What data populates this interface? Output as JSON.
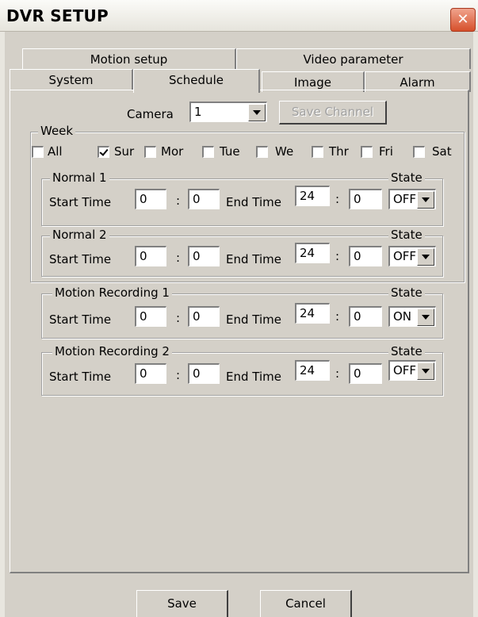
{
  "window": {
    "title": "DVR SETUP",
    "close_glyph": "✕"
  },
  "tabs_row1": [
    {
      "label": "Motion setup"
    },
    {
      "label": "Video parameter"
    }
  ],
  "tabs_row2": [
    {
      "label": "System"
    },
    {
      "label": "Schedule"
    },
    {
      "label": "Image"
    },
    {
      "label": "Alarm"
    }
  ],
  "camera": {
    "label": "Camera",
    "value": "1"
  },
  "save_channel": "Save Channel",
  "week": {
    "label": "Week",
    "days": [
      {
        "label": "All",
        "checked": false
      },
      {
        "label": "Sur",
        "checked": true
      },
      {
        "label": "Mor",
        "checked": false
      },
      {
        "label": "Tue",
        "checked": false
      },
      {
        "label": "We",
        "checked": false
      },
      {
        "label": "Thr",
        "checked": false
      },
      {
        "label": "Fri",
        "checked": false
      },
      {
        "label": "Sat",
        "checked": false
      }
    ]
  },
  "labels": {
    "start_time": "Start Time",
    "end_time": "End Time",
    "state": "State",
    "colon": ":"
  },
  "schedules": [
    {
      "title": "Normal 1",
      "start_h": "0",
      "start_m": "0",
      "end_h": "24",
      "end_m": "0",
      "state": "OFF"
    },
    {
      "title": "Normal 2",
      "start_h": "0",
      "start_m": "0",
      "end_h": "24",
      "end_m": "0",
      "state": "OFF"
    },
    {
      "title": "Motion Recording 1",
      "start_h": "0",
      "start_m": "0",
      "end_h": "24",
      "end_m": "0",
      "state": "ON"
    },
    {
      "title": "Motion Recording 2",
      "start_h": "0",
      "start_m": "0",
      "end_h": "24",
      "end_m": "0",
      "state": "OFF"
    }
  ],
  "footer": {
    "save": "Save",
    "cancel": "Cancel"
  }
}
